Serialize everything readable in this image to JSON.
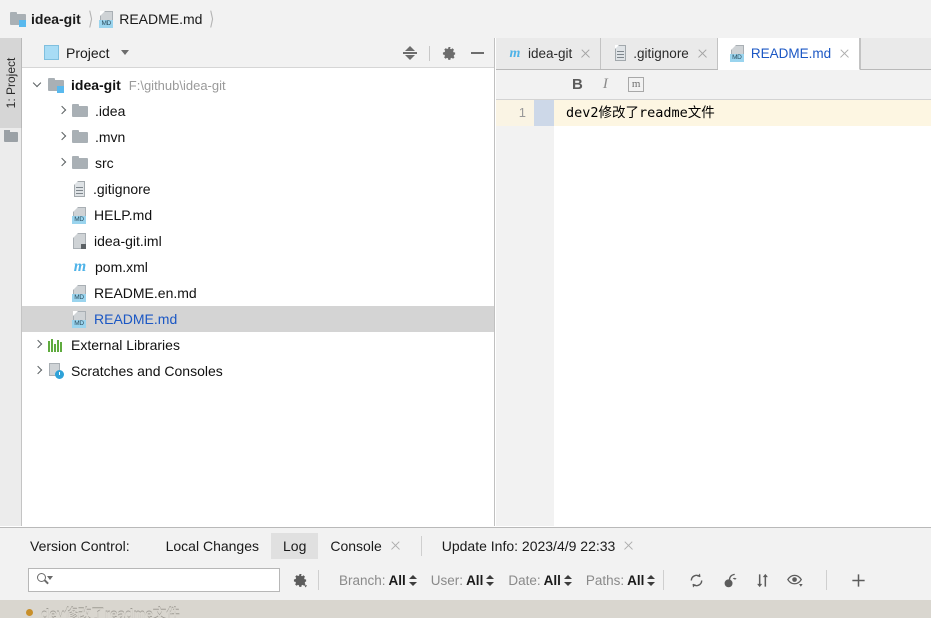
{
  "breadcrumb": {
    "items": [
      {
        "label": "idea-git",
        "icon": "module-icon",
        "bold": true
      },
      {
        "label": "README.md",
        "icon": "markdown-file-icon",
        "bold": false
      }
    ]
  },
  "left_strip": {
    "tool_window_label": "1: Project",
    "folder_icon": "folder-icon"
  },
  "project_panel": {
    "title": "Project",
    "title_icon": "project-view-icon",
    "tools": [
      {
        "name": "collapse-all-icon",
        "label": "Collapse All"
      },
      {
        "name": "gear-icon",
        "label": "Settings"
      },
      {
        "name": "minimize-icon",
        "label": "Hide"
      }
    ],
    "tree": [
      {
        "label": "idea-git",
        "path": "F:\\github\\idea-git",
        "icon": "module-icon",
        "indent": 0,
        "arrow": "down",
        "bold": true,
        "selected": false,
        "link": false
      },
      {
        "label": ".idea",
        "path": "",
        "icon": "folder-icon",
        "indent": 1,
        "arrow": "right",
        "bold": false,
        "selected": false,
        "link": false
      },
      {
        "label": ".mvn",
        "path": "",
        "icon": "folder-icon",
        "indent": 1,
        "arrow": "right",
        "bold": false,
        "selected": false,
        "link": false
      },
      {
        "label": "src",
        "path": "",
        "icon": "folder-icon",
        "indent": 1,
        "arrow": "right",
        "bold": false,
        "selected": false,
        "link": false
      },
      {
        "label": ".gitignore",
        "path": "",
        "icon": "text-file-icon",
        "indent": 1,
        "arrow": "none",
        "bold": false,
        "selected": false,
        "link": false
      },
      {
        "label": "HELP.md",
        "path": "",
        "icon": "markdown-file-icon",
        "indent": 1,
        "arrow": "none",
        "bold": false,
        "selected": false,
        "link": false
      },
      {
        "label": "idea-git.iml",
        "path": "",
        "icon": "iml-file-icon",
        "indent": 1,
        "arrow": "none",
        "bold": false,
        "selected": false,
        "link": false
      },
      {
        "label": "pom.xml",
        "path": "",
        "icon": "maven-file-icon",
        "indent": 1,
        "arrow": "none",
        "bold": false,
        "selected": false,
        "link": false
      },
      {
        "label": "README.en.md",
        "path": "",
        "icon": "markdown-file-icon",
        "indent": 1,
        "arrow": "none",
        "bold": false,
        "selected": false,
        "link": false
      },
      {
        "label": "README.md",
        "path": "",
        "icon": "markdown-file-icon",
        "indent": 1,
        "arrow": "none",
        "bold": false,
        "selected": true,
        "link": true
      },
      {
        "label": "External Libraries",
        "path": "",
        "icon": "library-icon",
        "indent": 0,
        "arrow": "right",
        "bold": false,
        "selected": false,
        "link": false
      },
      {
        "label": "Scratches and Consoles",
        "path": "",
        "icon": "scratches-icon",
        "indent": 0,
        "arrow": "right",
        "bold": false,
        "selected": false,
        "link": false
      }
    ]
  },
  "editor": {
    "tabs": [
      {
        "label": "idea-git",
        "icon": "maven-file-icon",
        "active": false,
        "closable": true
      },
      {
        "label": ".gitignore",
        "icon": "text-file-icon",
        "active": false,
        "closable": true
      },
      {
        "label": "README.md",
        "icon": "markdown-file-icon",
        "active": true,
        "closable": true
      }
    ],
    "format_toolbar": [
      {
        "name": "bold-button",
        "label": "B"
      },
      {
        "name": "italic-button",
        "label": "I"
      },
      {
        "name": "code-button",
        "label": "m"
      }
    ],
    "lines": [
      {
        "number": "1",
        "text": "dev2修改了readme文件",
        "highlighted": true
      }
    ]
  },
  "version_control": {
    "panel_label": "Version Control:",
    "tabs": [
      {
        "label": "Local Changes",
        "active": false,
        "closable": false
      },
      {
        "label": "Log",
        "active": true,
        "closable": false
      },
      {
        "label": "Console",
        "active": false,
        "closable": true
      },
      {
        "label": "Update Info: 2023/4/9 22:33",
        "active": false,
        "closable": true
      }
    ],
    "search": {
      "placeholder": "",
      "value": "",
      "icon": "search-icon"
    },
    "settings_icon": "gear-icon",
    "filters": [
      {
        "label": "Branch:",
        "value": "All"
      },
      {
        "label": "User:",
        "value": "All"
      },
      {
        "label": "Date:",
        "value": "All"
      },
      {
        "label": "Paths:",
        "value": "All"
      }
    ],
    "actions": [
      {
        "name": "refresh-icon",
        "label": "Refresh"
      },
      {
        "name": "cherry-pick-icon",
        "label": "Cherry-Pick"
      },
      {
        "name": "sort-icon",
        "label": "Intellisort"
      },
      {
        "name": "eye-icon",
        "label": "Show"
      },
      {
        "name": "plus-icon",
        "label": "Add Tab"
      }
    ],
    "commits": [
      {
        "message": "dev修改了readme文件",
        "dot_color": "#c88f2a"
      }
    ]
  },
  "colors": {
    "accent_link": "#1b57c4",
    "selection": "#d4d4d4",
    "line_highlight": "#fdf6e2",
    "panel_bg": "#f2f2f2",
    "md_badge": "#9ad4ee"
  }
}
